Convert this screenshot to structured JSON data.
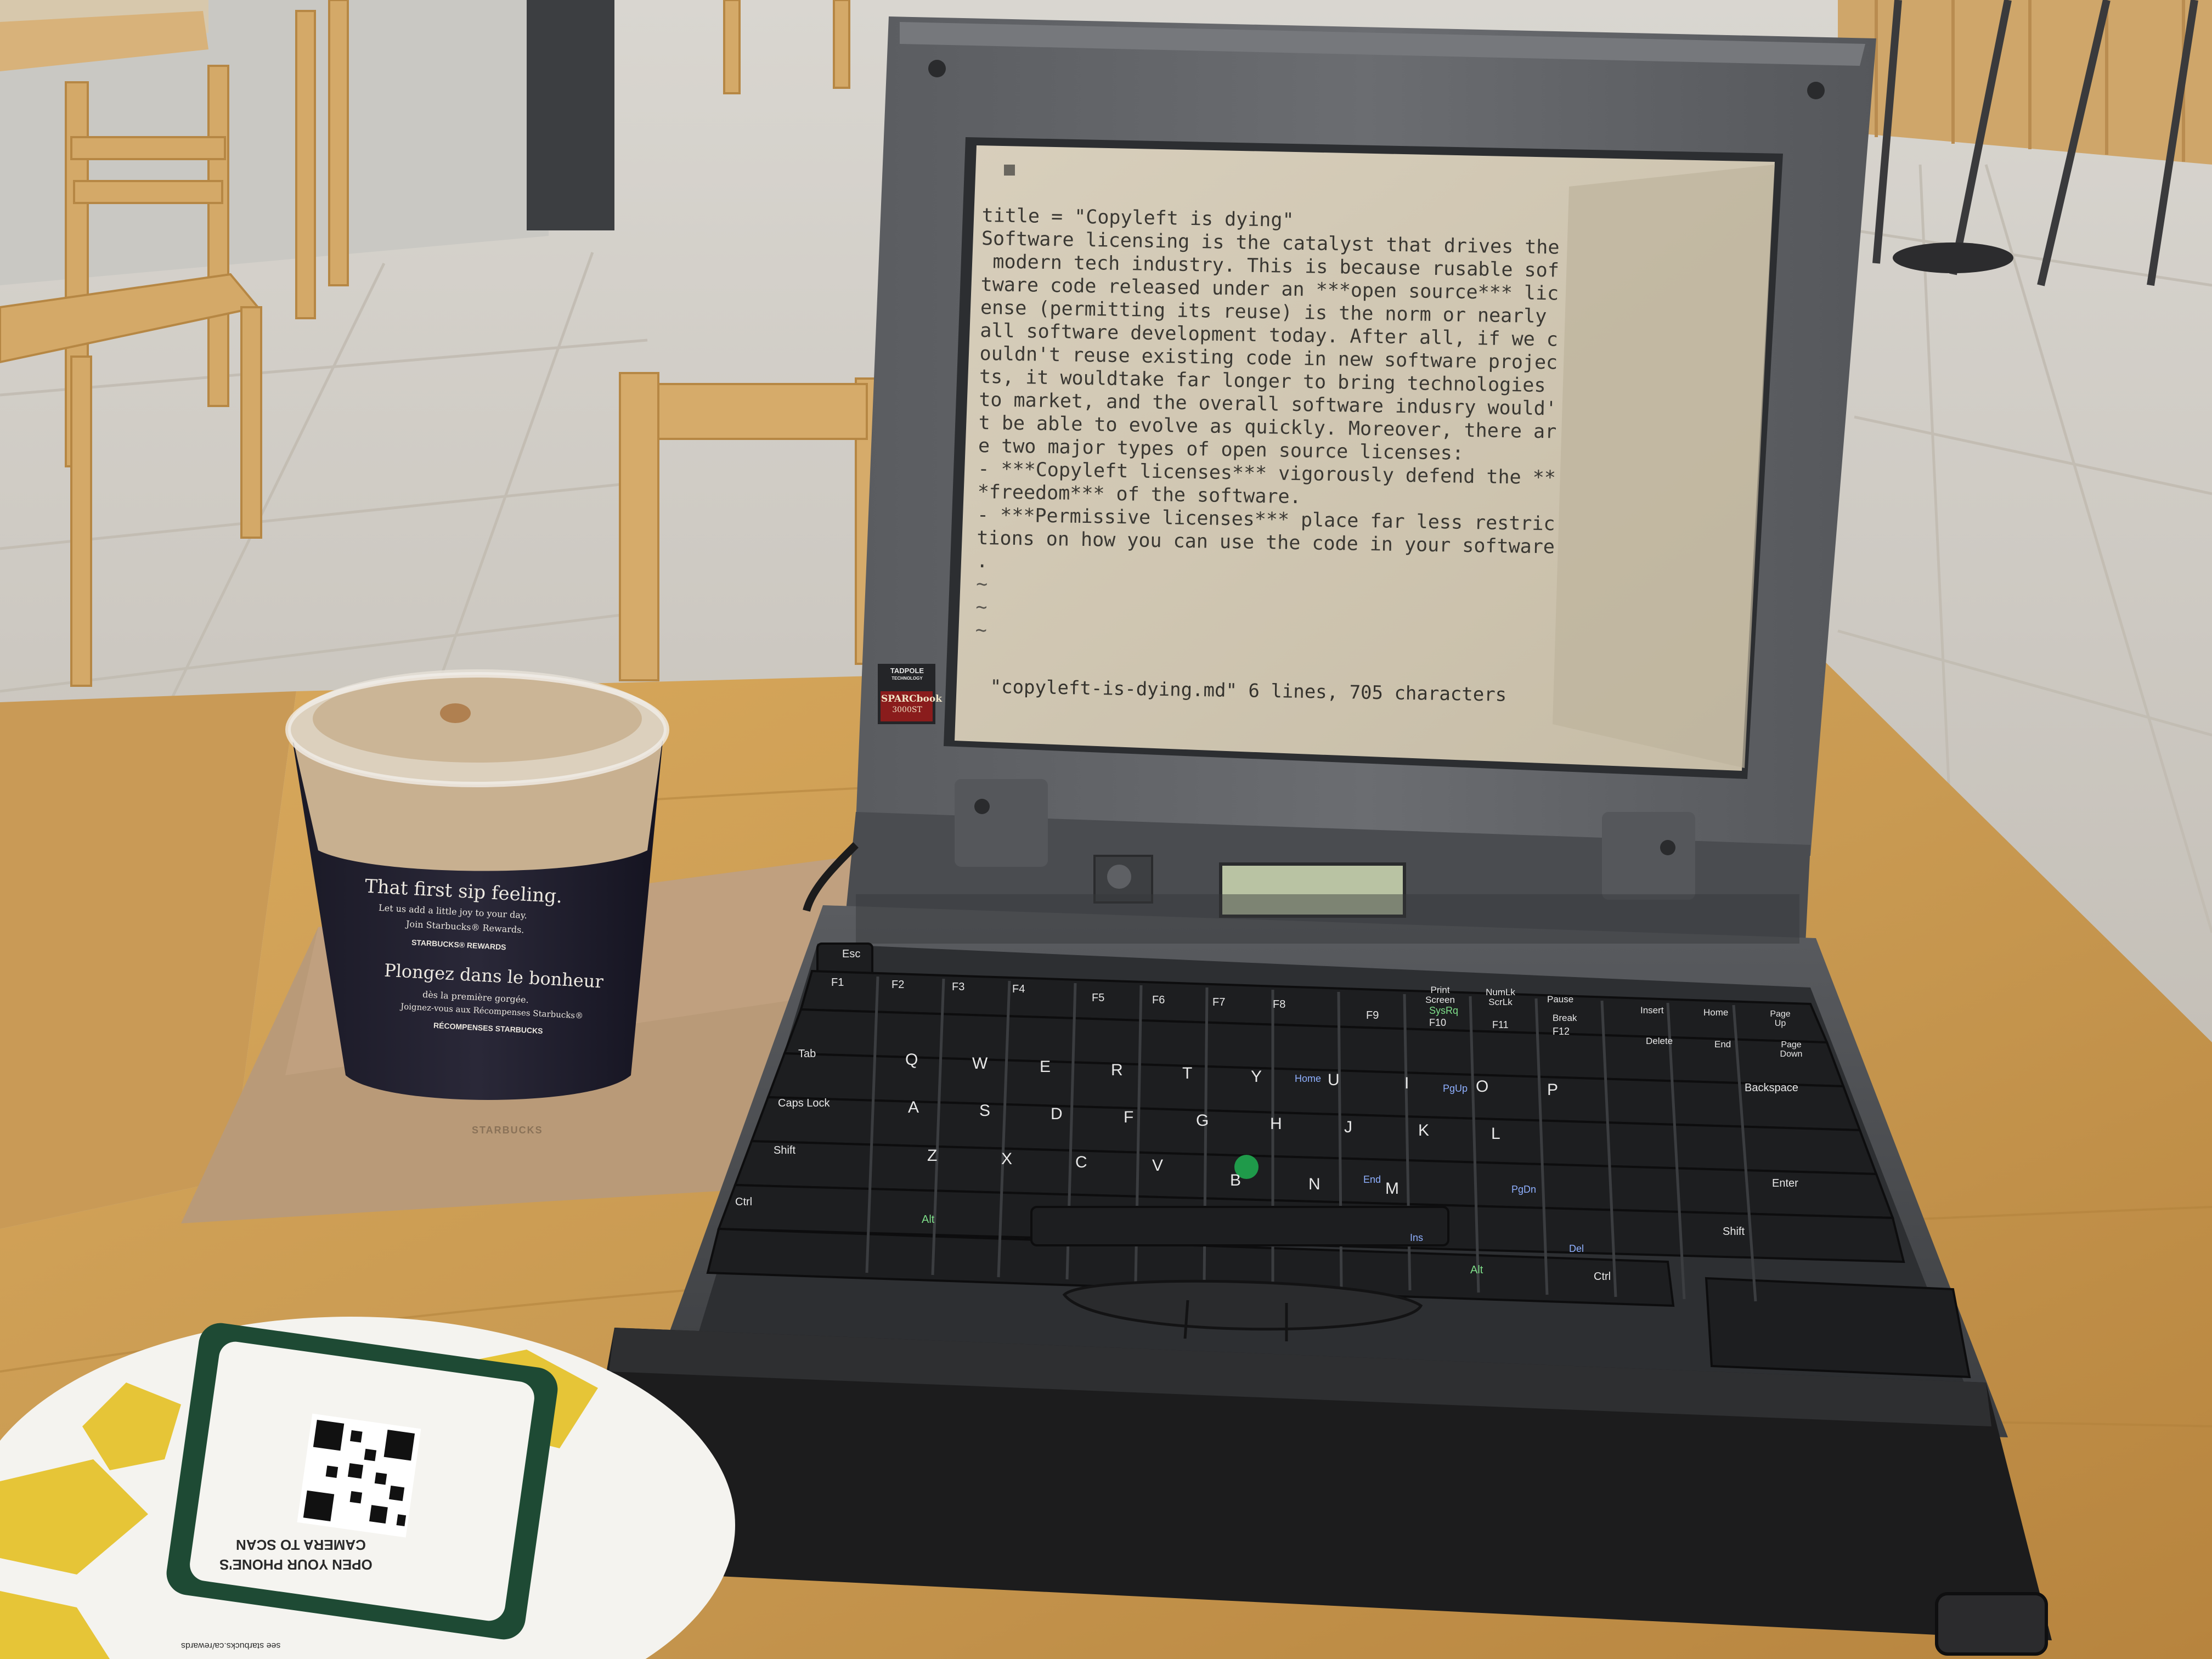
{
  "editor": {
    "lines": [
      "title = \"Copyleft is dying\"",
      "",
      "Software licensing is the catalyst that drives the",
      " modern tech industry. This is because rusable sof",
      "tware code released under an ***open source*** lic",
      "ense (permitting its reuse) is the norm or nearly",
      "all software development today. After all, if we c",
      "ouldn't reuse existing code in new software projec",
      "ts, it wouldtake far longer to bring technologies",
      "to market, and the overall software indusry would'",
      "t be able to evolve as quickly. Moreover, there ar",
      "e two major types of open source licenses:",
      "",
      "- ***Copyleft licenses*** vigorously defend the **",
      "*freedom*** of the software.",
      "- ***Permissive licenses*** place far less restric",
      "tions on how you can use the code in your software",
      "."
    ],
    "tildes": [
      "~",
      "~",
      "~"
    ],
    "status": "\"copyleft-is-dying.md\" 6 lines, 705 characters"
  },
  "laptop": {
    "brand": "TADPOLE",
    "brand_sub": "TECHNOLOGY",
    "model": "SPARCbook",
    "model_num": "3000ST"
  },
  "keyboard": {
    "esc": "Esc",
    "fkeys": [
      "F1",
      "F2",
      "F3",
      "F4",
      "F5",
      "F6",
      "F7",
      "F8",
      "F9",
      "F10",
      "F11",
      "F12"
    ],
    "print_screen": "Print Screen",
    "sysrq": "SysRq",
    "numlk": "NumLk ScrLk",
    "pause": "Pause",
    "break": "Break",
    "insert": "Insert",
    "home": "Home",
    "pageup": "Page Up",
    "delete": "Delete",
    "end": "End",
    "pagedown": "Page Down",
    "tab": "Tab",
    "caps": "Caps Lock",
    "shift_l": "Shift",
    "shift_r": "Shift",
    "ctrl_l": "Ctrl",
    "ctrl_r": "Ctrl",
    "alt_l": "Alt",
    "alt_r": "Alt",
    "backspace": "Backspace",
    "enter": "Enter",
    "row_q": [
      "Q",
      "W",
      "E",
      "R",
      "T",
      "Y",
      "U",
      "I",
      "O",
      "P"
    ],
    "row_a": [
      "A",
      "S",
      "D",
      "F",
      "G",
      "H",
      "J",
      "K",
      "L"
    ],
    "row_z": [
      "Z",
      "X",
      "C",
      "V",
      "B",
      "N",
      "M"
    ],
    "num_home": "Home",
    "num_pgup": "PgUp",
    "num_end": "End",
    "num_pgdn": "PgDn",
    "num_ins": "Ins",
    "num_del": "Del"
  },
  "cup": {
    "line1": "That first sip feeling.",
    "line2": "Let us add a little joy to your day.",
    "line3": "Join Starbucks® Rewards.",
    "rewards": "STARBUCKS® REWARDS",
    "line4": "Plongez dans le bonheur",
    "line5": "dès la première gorgée.",
    "line6": "Joignez-vous aux Récompenses Starbucks®",
    "rewards_fr": "RÉCOMPENSES STARBUCKS",
    "napkin": "STARBUCKS"
  },
  "card": {
    "line1": "OPEN YOUR PHONE'S",
    "line2": "CAMERA TO SCAN",
    "url": "see starbucks.ca/rewards"
  },
  "colors": {
    "table": "#c99a52",
    "laptop": "#4e5054",
    "screen": "#cfc6b2",
    "keys": "#1d1e20",
    "trackpoint": "#1f9a4a",
    "cup_sleeve": "#1c1b2a",
    "coffee_foam": "#c8b090",
    "star": "#e6c537",
    "card_green": "#1e4a34"
  }
}
